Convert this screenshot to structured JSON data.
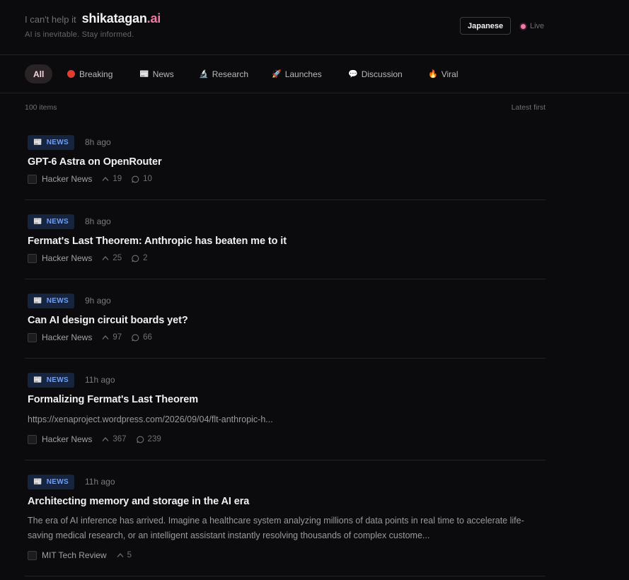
{
  "header": {
    "tagline_prefix": "I can't help it",
    "brand_main": "shikatagan",
    "brand_ext": ".ai",
    "subtitle": "AI is inevitable. Stay informed.",
    "language_button": "Japanese",
    "status": "Live"
  },
  "filters": [
    {
      "label": "All",
      "icon": "",
      "active": true
    },
    {
      "label": "Breaking",
      "icon": "red-circle"
    },
    {
      "label": "News",
      "icon": "newspaper"
    },
    {
      "label": "Research",
      "icon": "microscope"
    },
    {
      "label": "Launches",
      "icon": "rocket"
    },
    {
      "label": "Discussion",
      "icon": "speech-bubble"
    },
    {
      "label": "Viral",
      "icon": "fire"
    }
  ],
  "list_meta": {
    "count": "100 items",
    "sort": "Latest first"
  },
  "items": [
    {
      "badge": "NEWS",
      "time": "8h ago",
      "title": "GPT-6 Astra on OpenRouter",
      "summary": "",
      "source": "Hacker News",
      "upvotes": "19",
      "comments": "10"
    },
    {
      "badge": "NEWS",
      "time": "8h ago",
      "title": "Fermat's Last Theorem: Anthropic has beaten me to it",
      "summary": "",
      "source": "Hacker News",
      "upvotes": "25",
      "comments": "2"
    },
    {
      "badge": "NEWS",
      "time": "9h ago",
      "title": "Can AI design circuit boards yet?",
      "summary": "",
      "source": "Hacker News",
      "upvotes": "97",
      "comments": "66"
    },
    {
      "badge": "NEWS",
      "time": "11h ago",
      "title": "Formalizing Fermat's Last Theorem",
      "summary": "https://xenaproject.wordpress.com/2026/09/04/flt-anthropic-h...",
      "source": "Hacker News",
      "upvotes": "367",
      "comments": "239"
    },
    {
      "badge": "NEWS",
      "time": "11h ago",
      "title": "Architecting memory and storage in the AI era",
      "summary": "The era of AI inference has arrived. Imagine a healthcare system analyzing millions of data points in real time to accelerate life-saving medical research, or an intelligent assistant instantly resolving thousands of complex custome...",
      "source": "MIT Tech Review",
      "upvotes": "5",
      "comments": ""
    }
  ],
  "colors": {
    "background": "#0b0b0d",
    "accent_pink": "#f07aa8",
    "badge_blue": "#6aa0ff",
    "breaking_red": "#e53b2f"
  }
}
